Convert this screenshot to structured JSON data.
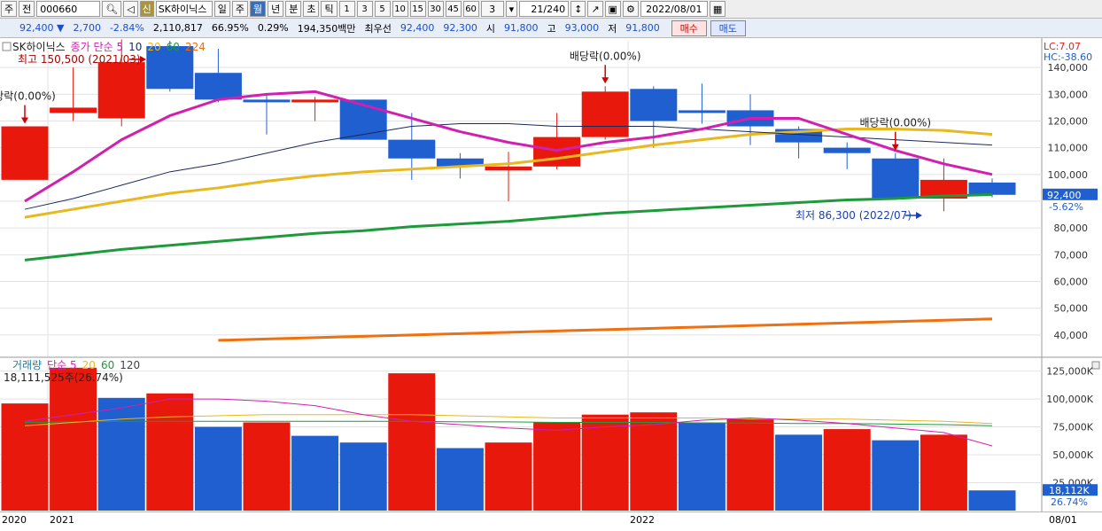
{
  "toolbar": {
    "items": [
      "주",
      "전",
      "000660",
      "신",
      "SK하이닉스",
      "일",
      "주",
      "월",
      "년",
      "분",
      "초",
      "틱",
      "1",
      "3",
      "5",
      "10",
      "15",
      "30",
      "45",
      "60",
      "3",
      "21/240",
      "2022/08/01"
    ],
    "selected_period": "월"
  },
  "quote": {
    "price": "92,400 ▼",
    "change": "2,700",
    "change_pct": "-2.84%",
    "volume": "2,110,817",
    "ratio1": "66.95%",
    "ratio2": "0.29%",
    "amount": "194,350백만",
    "best_label": "최우선",
    "ask": "92,400",
    "bid": "92,300",
    "open_label": "시",
    "open": "91,800",
    "high_label": "고",
    "high": "93,000",
    "low_label": "저",
    "low": "91,800",
    "buy_label": "매수",
    "sell_label": "매도"
  },
  "colors": {
    "up": "#e8190c",
    "down": "#1f5fcf",
    "ma5": "#d020b0",
    "ma10": "#1a2a5a",
    "ma20": "#e8b820",
    "ma60": "#1e9a3a",
    "ma224": "#ee7010"
  },
  "chart_data": [
    {
      "type": "candlestick",
      "legend": [
        "SK하이닉스",
        "종가 단순 5",
        "10",
        "20",
        "60",
        "224"
      ],
      "top_right": [
        "LC:7.07",
        "HC:-38.60"
      ],
      "y_ticks": [
        "140,000",
        "130,000",
        "120,000",
        "110,000",
        "100,000",
        "92,400",
        "80,000",
        "70,000",
        "60,000",
        "50,000",
        "40,000"
      ],
      "ylim": [
        32000,
        150000
      ],
      "last_price": "92,400",
      "last_change": "-5.62%",
      "candles": [
        {
          "o": 98000,
          "h": 118000,
          "l": 98000,
          "c": 118000
        },
        {
          "o": 123000,
          "h": 140000,
          "l": 120000,
          "c": 125000
        },
        {
          "o": 121000,
          "h": 150500,
          "l": 118000,
          "c": 142000
        },
        {
          "o": 148000,
          "h": 150000,
          "l": 131000,
          "c": 132000
        },
        {
          "o": 138000,
          "h": 147000,
          "l": 127000,
          "c": 128000
        },
        {
          "o": 128000,
          "h": 130000,
          "l": 115000,
          "c": 127000
        },
        {
          "o": 127000,
          "h": 129000,
          "l": 120000,
          "c": 128000
        },
        {
          "o": 128000,
          "h": 128000,
          "l": 113000,
          "c": 113000
        },
        {
          "o": 113000,
          "h": 123000,
          "l": 98000,
          "c": 106000
        },
        {
          "o": 106000,
          "h": 108000,
          "l": 98500,
          "c": 103000
        },
        {
          "o": 101500,
          "h": 108500,
          "l": 90000,
          "c": 103000
        },
        {
          "o": 103000,
          "h": 123000,
          "l": 102000,
          "c": 114000
        },
        {
          "o": 114000,
          "h": 133000,
          "l": 113000,
          "c": 131000
        },
        {
          "o": 132000,
          "h": 133000,
          "l": 110000,
          "c": 120000
        },
        {
          "o": 124000,
          "h": 134000,
          "l": 119000,
          "c": 123000
        },
        {
          "o": 124000,
          "h": 130000,
          "l": 111000,
          "c": 118000
        },
        {
          "o": 117000,
          "h": 118000,
          "l": 106000,
          "c": 112000
        },
        {
          "o": 110000,
          "h": 112000,
          "l": 102000,
          "c": 108000
        },
        {
          "o": 106000,
          "h": 108000,
          "l": 91000,
          "c": 91000
        },
        {
          "o": 91000,
          "h": 106000,
          "l": 86300,
          "c": 98000
        },
        {
          "o": 97000,
          "h": 98500,
          "l": 91500,
          "c": 92400
        }
      ],
      "ma5": [
        90000,
        101000,
        113000,
        122000,
        128000,
        130000,
        131000,
        126000,
        121000,
        116000,
        112000,
        109000,
        112000,
        114000,
        117000,
        121000,
        121000,
        115000,
        109000,
        104000,
        100000
      ],
      "ma10": [
        87000,
        91000,
        96000,
        101000,
        104000,
        108000,
        112000,
        115000,
        118000,
        119000,
        119000,
        118000,
        118000,
        118000,
        117000,
        116000,
        115000,
        114000,
        113000,
        112000,
        111000
      ],
      "ma20": [
        84000,
        87000,
        90000,
        93000,
        95000,
        97500,
        99500,
        101000,
        102000,
        103000,
        104000,
        106000,
        108500,
        111000,
        113000,
        115000,
        116000,
        117000,
        117000,
        116500,
        115000
      ],
      "ma60": [
        68000,
        70000,
        72000,
        73500,
        75000,
        76500,
        78000,
        79000,
        80500,
        81500,
        82500,
        84000,
        85500,
        86500,
        87500,
        88500,
        89500,
        90500,
        91000,
        92000,
        92500
      ],
      "ma224": [
        null,
        null,
        null,
        null,
        38000,
        38500,
        39000,
        39500,
        40000,
        40500,
        41000,
        41500,
        42000,
        42500,
        43000,
        43500,
        44000,
        44500,
        45000,
        45500,
        46000
      ],
      "annotations": [
        {
          "text": "당락(0.00%)",
          "index": 0,
          "arrow": "down"
        },
        {
          "text": "최고 150,500 (2021/03)",
          "index": 2,
          "arrow": "right"
        },
        {
          "text": "배당락(0.00%)",
          "index": 12,
          "arrow": "down"
        },
        {
          "text": "배당락(0.00%)",
          "index": 18,
          "arrow": "down"
        },
        {
          "text": "최저 86,300 (2022/07)",
          "index": 19,
          "arrow": "right"
        }
      ]
    },
    {
      "type": "bar",
      "legend": [
        "거래량",
        "단순 5",
        "20",
        "60",
        "120"
      ],
      "top_left": "18,111,525주(26.74%)",
      "y_ticks": [
        "125,000K",
        "100,000K",
        "75,000K",
        "50,000K",
        "25,000K"
      ],
      "ylim": [
        0,
        135000
      ],
      "last_value": "18,112K",
      "last_pct": "26.74%",
      "values": [
        96000,
        128000,
        101000,
        105000,
        75000,
        79000,
        67000,
        61000,
        123000,
        56000,
        61000,
        79000,
        86000,
        88000,
        79000,
        82000,
        68000,
        73000,
        63000,
        68000,
        18112
      ],
      "up": [
        true,
        true,
        false,
        true,
        false,
        true,
        false,
        false,
        true,
        false,
        true,
        true,
        true,
        true,
        false,
        true,
        false,
        true,
        false,
        true,
        false
      ],
      "ma5": [
        80000,
        86000,
        92000,
        100000,
        100000,
        98000,
        94000,
        86000,
        80000,
        77000,
        74000,
        72000,
        75000,
        77000,
        81000,
        83000,
        81000,
        78000,
        74000,
        70000,
        58000
      ],
      "ma20": [
        76000,
        79000,
        82000,
        84000,
        85000,
        86000,
        86000,
        86000,
        86000,
        85000,
        84000,
        83000,
        83000,
        83000,
        83000,
        82000,
        82000,
        82000,
        81000,
        80000,
        78000
      ],
      "ma60": [
        79000,
        79500,
        80000,
        80000,
        80000,
        80000,
        80000,
        80000,
        80000,
        79500,
        79500,
        79000,
        79000,
        79000,
        78500,
        78500,
        78000,
        78000,
        77500,
        77000,
        76000
      ]
    }
  ],
  "time_axis": {
    "labels": [
      "2020",
      "2021",
      "2022",
      "08/01"
    ]
  }
}
